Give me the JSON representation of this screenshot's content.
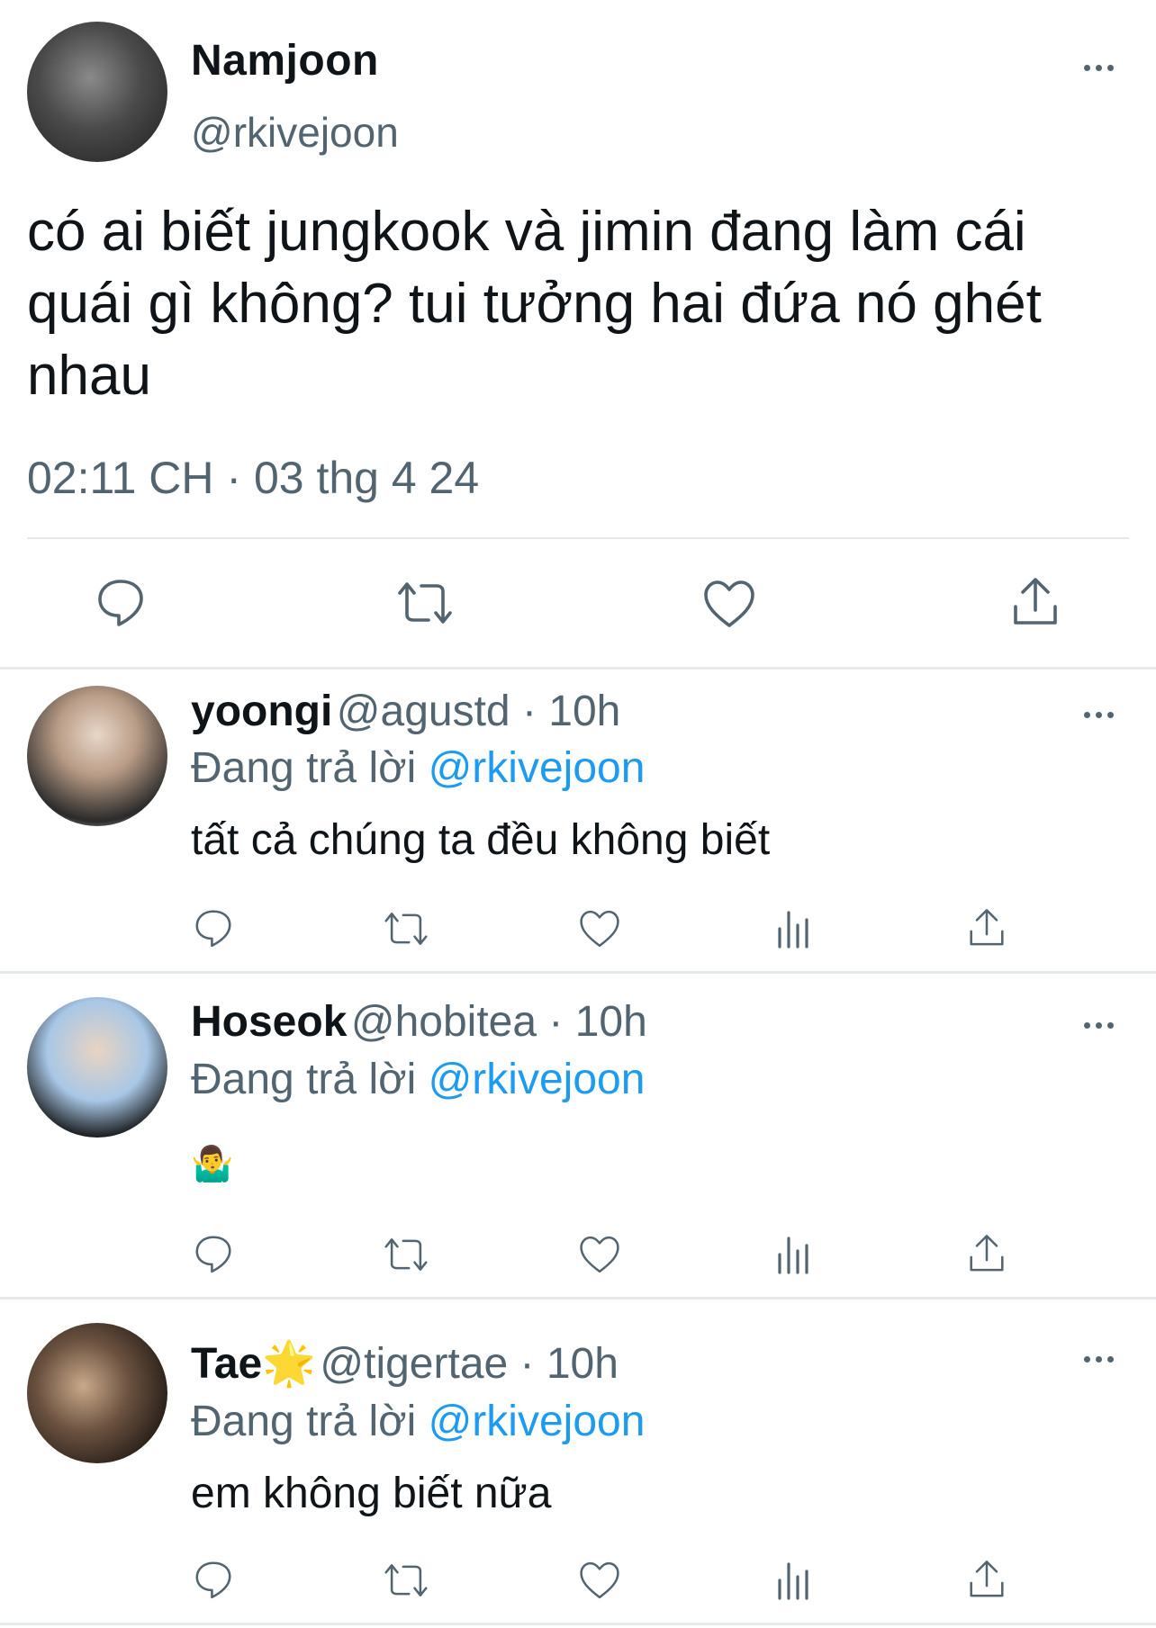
{
  "main_tweet": {
    "name": "Namjoon",
    "handle": "@rkivejoon",
    "text": "có ai biết jungkook và jimin đang làm cái quái gì không? tui tưởng hai đứa nó ghét nhau",
    "timestamp": "02:11 CH · 03 thg 4 24",
    "actions": [
      "reply-icon",
      "retweet-icon",
      "like-icon",
      "share-icon"
    ]
  },
  "replies": [
    {
      "name": "yoongi",
      "meta": "@agustd · 10h",
      "replying_prefix": "Đang trả lời ",
      "replying_to": "@rkivejoon",
      "text": "tất cả chúng ta đều không biết"
    },
    {
      "name": "Hoseok",
      "meta": "@hobitea · 10h",
      "replying_prefix": "Đang trả lời ",
      "replying_to": "@rkivejoon",
      "text": "🤷‍♂️"
    },
    {
      "name": "Tae🌟",
      "meta": "@tigertae · 10h",
      "replying_prefix": "Đang trả lời ",
      "replying_to": "@rkivejoon",
      "text": "em không biết nữa"
    }
  ],
  "reply_actions": [
    "reply-icon",
    "retweet-icon",
    "like-icon",
    "views-icon",
    "share-icon"
  ],
  "colors": {
    "link": "#1d9bf0",
    "secondary": "#536471",
    "text": "#0f1419",
    "divider": "#e6e9ec"
  }
}
